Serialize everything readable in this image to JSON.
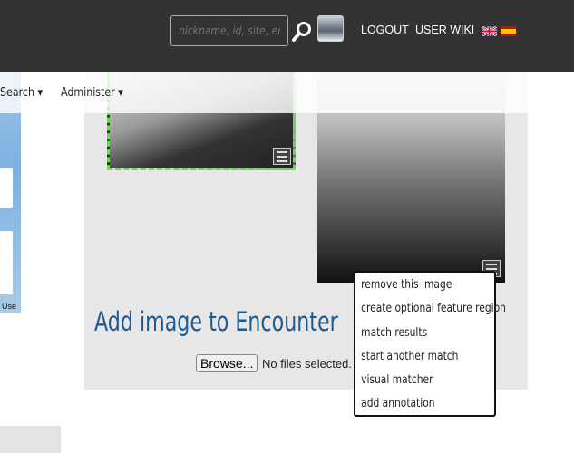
{
  "header": {
    "search_placeholder": "nickname, id, site, encounter",
    "logout": "LOGOUT",
    "user_wiki": "USER WIKI",
    "flags": [
      "english-flag",
      "spanish-flag"
    ]
  },
  "nav": {
    "items": [
      "Search",
      "Administer"
    ]
  },
  "map": {
    "terms": "Use"
  },
  "content": {
    "title": "Add image to Encounter",
    "browse_label": "Browse...",
    "file_status": "No files selected."
  },
  "image_menu": {
    "items": [
      "remove this image",
      "create optional feature region",
      "match results",
      "start another match",
      "visual matcher",
      "add annotation"
    ]
  },
  "colors": {
    "title": "#1e5a8e",
    "header_bg": "#333333",
    "selection": "#6ed65a"
  }
}
